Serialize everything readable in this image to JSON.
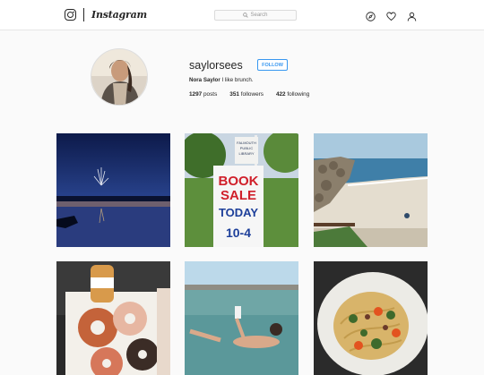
{
  "header": {
    "brand_name": "Instagram",
    "search_placeholder": "Search",
    "icons": [
      "instagram-camera-icon",
      "explore-compass-icon",
      "activity-heart-icon",
      "profile-person-icon",
      "search-icon"
    ]
  },
  "profile": {
    "username": "saylorsees",
    "follow_label": "FOLLOW",
    "full_name": "Nora Saylor",
    "bio_text": "I like brunch.",
    "stats": {
      "posts_count": "1297",
      "posts_label": "posts",
      "followers_count": "351",
      "followers_label": "followers",
      "following_count": "422",
      "following_label": "following"
    }
  },
  "posts": [
    {
      "subject": "fireworks over water at dusk"
    },
    {
      "subject": "book sale sign"
    },
    {
      "subject": "rocky beach and jetty"
    },
    {
      "subject": "donuts and iced coffee"
    },
    {
      "subject": "woman floating in sea reading"
    },
    {
      "subject": "pasta dish"
    }
  ],
  "sign": {
    "line1": "BOOK",
    "line2": "SALE",
    "line3": "TODAY",
    "line4": "10-4",
    "library": "FALMOUTH PUBLIC LIBRARY"
  },
  "colors": {
    "accent": "#3897f0",
    "text": "#262626",
    "background": "#fafafa"
  }
}
